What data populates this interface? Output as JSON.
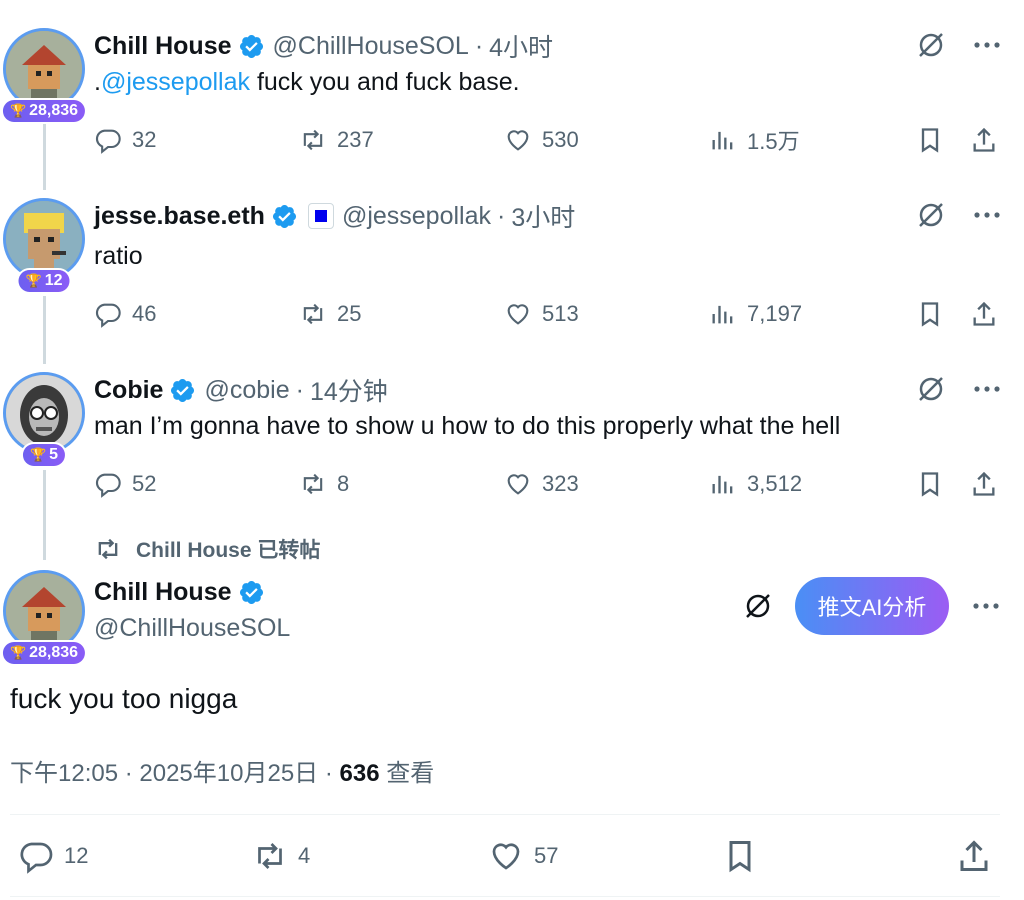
{
  "colors": {
    "accent": "#1d9bf0",
    "verified": "#1d9bf0",
    "muted": "#536471",
    "badge": "#7c5cf3"
  },
  "tweets": [
    {
      "name": "Chill House",
      "handle": "@ChillHouseSOL",
      "dot": "·",
      "time": "4小时",
      "badge": "28,836",
      "text_prefix": ".",
      "mention": "@jessepollak",
      "text": " fuck you and fuck base.",
      "replies": "32",
      "retweets": "237",
      "likes": "530",
      "views": "1.5万"
    },
    {
      "name": "jesse.base.eth",
      "handle": "@jessepollak",
      "dot": "·",
      "time": "3小时",
      "badge": "12",
      "text": "ratio",
      "replies": "46",
      "retweets": "25",
      "likes": "513",
      "views": "7,197"
    },
    {
      "name": "Cobie",
      "handle": "@cobie",
      "dot": "·",
      "time": "14分钟",
      "badge": "5",
      "text": "man I’m gonna have to show u how to do this properly what the hell",
      "replies": "52",
      "retweets": "8",
      "likes": "323",
      "views": "3,512"
    }
  ],
  "retweet_label": "Chill House 已转帖",
  "main": {
    "name": "Chill House",
    "handle": "@ChillHouseSOL",
    "badge": "28,836",
    "ai_button": "推文AI分析",
    "text": "fuck you too nigga",
    "time": "下午12:05 · 2025年10月25日 · ",
    "views": "636",
    "views_label": " 查看",
    "replies": "12",
    "retweets": "4",
    "likes": "57"
  }
}
